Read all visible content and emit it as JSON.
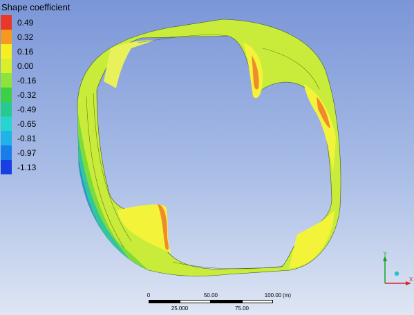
{
  "legend": {
    "title": "Shape coefficient",
    "ticks": [
      "0.49",
      "0.32",
      "0.16",
      "0.00",
      "-0.16",
      "-0.32",
      "-0.49",
      "-0.65",
      "-0.81",
      "-0.97",
      "-1.13"
    ],
    "colors": [
      "#e8382a",
      "#f59a1e",
      "#f7ef22",
      "#d8f02a",
      "#8ee23a",
      "#3ecf48",
      "#26c98e",
      "#25d6cf",
      "#1fb3ea",
      "#1a7de9",
      "#173fe4"
    ]
  },
  "scale": {
    "top_labels": [
      "0",
      "50.00",
      "100.00",
      "(m)"
    ],
    "bottom_labels": [
      "25.000",
      "75.00"
    ]
  },
  "axes": {
    "y_label": "Y",
    "x_label": "X"
  },
  "contour_colors": {
    "main": "#c9ec3a",
    "light": "#f3f33a",
    "orange": "#f08a2a",
    "green": "#7fdb3c",
    "teal": "#30c6a0",
    "blue": "#2a8be0"
  }
}
